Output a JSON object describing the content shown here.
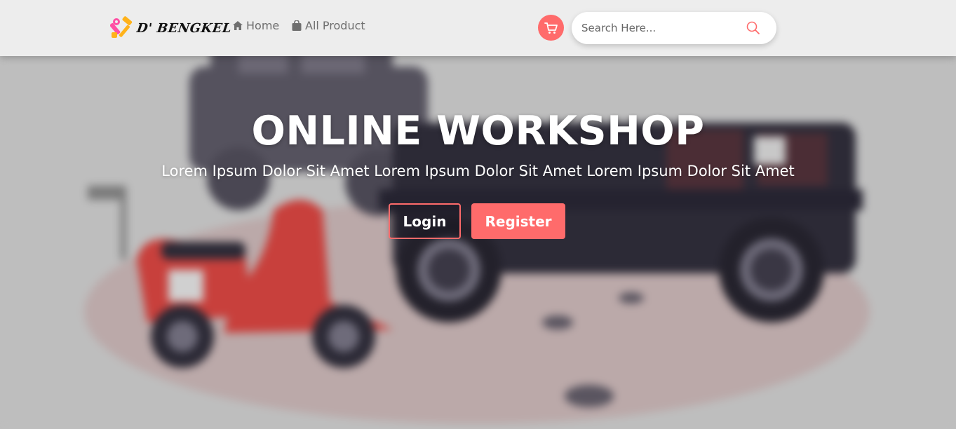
{
  "brand": {
    "name": "D' BENGKEL",
    "logo_icon": "tools-icon"
  },
  "nav": {
    "home": {
      "label": "Home",
      "icon": "home-icon"
    },
    "products": {
      "label": "All Product",
      "icon": "shopping-bag-icon"
    }
  },
  "cart": {
    "icon": "cart-icon"
  },
  "search": {
    "placeholder": "Search Here...",
    "icon": "search-icon"
  },
  "hero": {
    "title": "ONLINE WORKSHOP",
    "subtitle": "Lorem Ipsum Dolor Sit Amet Lorem Ipsum Dolor Sit Amet Lorem Ipsum Dolor Sit Amet",
    "login_label": "Login",
    "register_label": "Register"
  },
  "colors": {
    "accent": "#ff6b6b",
    "navbar_bg": "#ededed",
    "hero_overlay": "#bdbdbd",
    "jeep": "#2c2a36",
    "scooter": "#c8403c"
  }
}
